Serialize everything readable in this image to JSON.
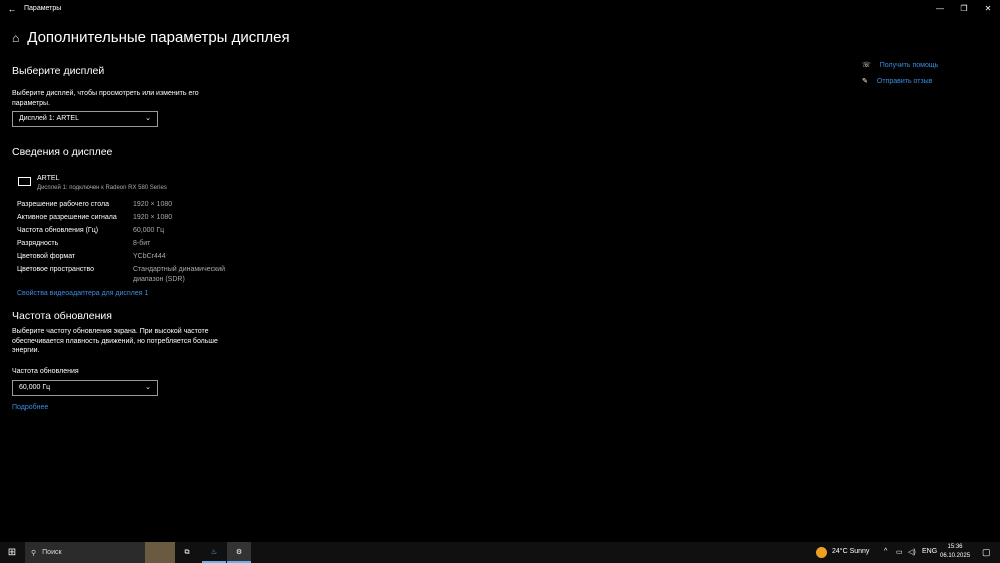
{
  "window": {
    "title": "Параметры",
    "minimize": "—",
    "restore": "❐",
    "close": "✕"
  },
  "page": {
    "title": "Дополнительные параметры дисплея"
  },
  "select_display": {
    "heading": "Выберите дисплей",
    "description": "Выберите дисплей, чтобы просмотреть или изменить его параметры.",
    "value": "Дисплей 1: ARTEL"
  },
  "display_info": {
    "heading": "Сведения о дисплее",
    "name": "ARTEL",
    "subtitle": "Дисплей 1: подключен к Radeon RX 580 Series",
    "rows": [
      {
        "k": "Разрешение рабочего стола",
        "v": "1920 × 1080"
      },
      {
        "k": "Активное разрешение сигнала",
        "v": "1920 × 1080"
      },
      {
        "k": "Частота обновления (Гц)",
        "v": "60,000 Гц"
      },
      {
        "k": "Разрядность",
        "v": "8-бит"
      },
      {
        "k": "Цветовой формат",
        "v": "YCbCr444"
      },
      {
        "k": "Цветовое пространство",
        "v": "Стандартный динамический диапазон (SDR)"
      }
    ],
    "adapter_link": "Свойства видеоадаптера для дисплея 1"
  },
  "refresh": {
    "heading": "Частота обновления",
    "description": "Выберите частоту обновления экрана. При высокой частоте обеспечивается плавность движений, но потребляется больше энергии.",
    "label": "Частота обновления",
    "value": "60,000 Гц",
    "more_link": "Подробнее"
  },
  "side": {
    "help": "Получить помощь",
    "feedback": "Отправить отзыв"
  },
  "taskbar": {
    "search": "Поиск",
    "weather": "24°C  Sunny",
    "lang": "ENG",
    "time": "15:36",
    "date": "06.10.2025"
  }
}
